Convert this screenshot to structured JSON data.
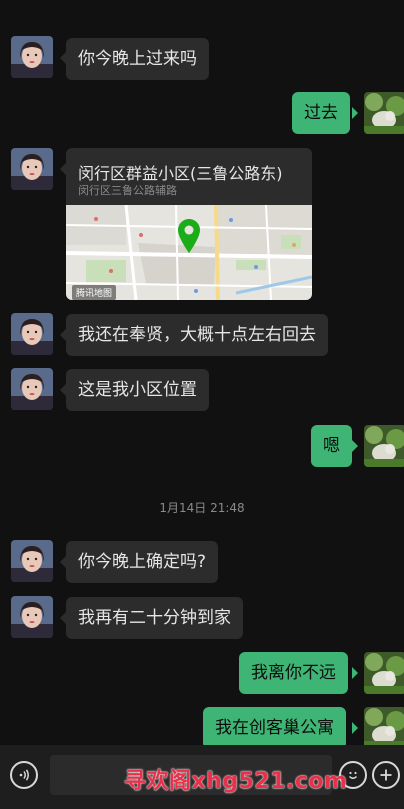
{
  "messages": [
    {
      "side": "in",
      "text": "你今晚上过来吗"
    },
    {
      "side": "out",
      "text": "过去"
    },
    {
      "side": "in",
      "type": "location",
      "title": "闵行区群益小区(三鲁公路东)",
      "subtitle": "闵行区三鲁公路辅路"
    },
    {
      "side": "in",
      "text": "我还在奉贤，大概十点左右回去"
    },
    {
      "side": "in",
      "text": "这是我小区位置"
    },
    {
      "side": "out",
      "text": "嗯"
    },
    {
      "side": "in",
      "text": "你今晚上确定吗?"
    },
    {
      "side": "in",
      "text": "我再有二十分钟到家"
    },
    {
      "side": "out",
      "text": "我离你不远"
    },
    {
      "side": "out",
      "text": "我在创客巢公寓"
    }
  ],
  "timestamp": "1月14日 21:48",
  "map": {
    "badge": "腾讯地图",
    "pin_color": "#1aad19"
  },
  "input_bar": {
    "value": "",
    "voice_icon": "voice-icon",
    "emoji_icon": "emoji-icon",
    "plus_icon": "plus-icon"
  },
  "watermark": "寻欢阁xhg521.com",
  "colors": {
    "background": "#111111",
    "incoming_bubble": "#2c2c2c",
    "outgoing_bubble": "#3eb575",
    "watermark": "#e8304a"
  }
}
